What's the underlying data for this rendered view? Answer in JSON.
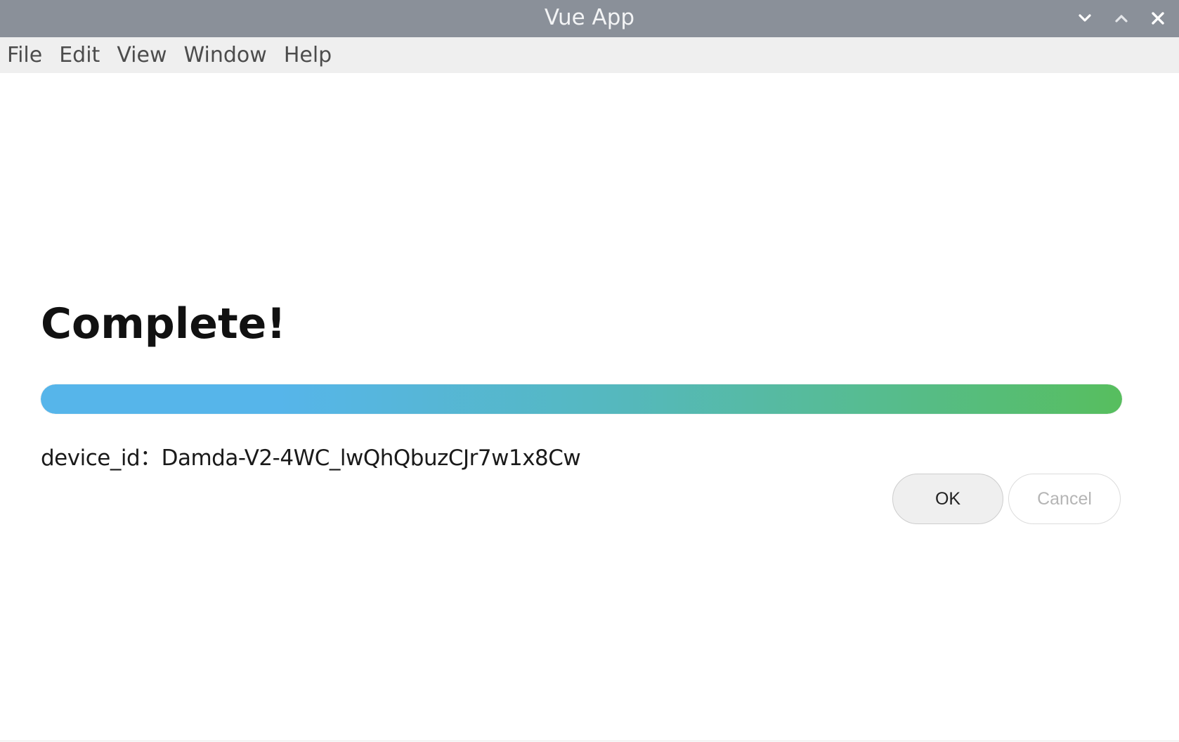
{
  "window": {
    "title": "Vue App",
    "controls": {
      "minimize_icon": "chevron-down-icon",
      "maximize_icon": "chevron-up-icon",
      "close_icon": "close-icon"
    }
  },
  "menubar": {
    "items": [
      "File",
      "Edit",
      "View",
      "Window",
      "Help"
    ]
  },
  "main": {
    "heading": "Complete!",
    "progress": {
      "percent": 100,
      "gradient_start": "#56b5ea",
      "gradient_end": "#57be5e"
    },
    "device_line": "device_id：Damda-V2-4WC_lwQhQbuzCJr7w1x8Cw",
    "buttons": {
      "ok_label": "OK",
      "cancel_label": "Cancel"
    }
  }
}
